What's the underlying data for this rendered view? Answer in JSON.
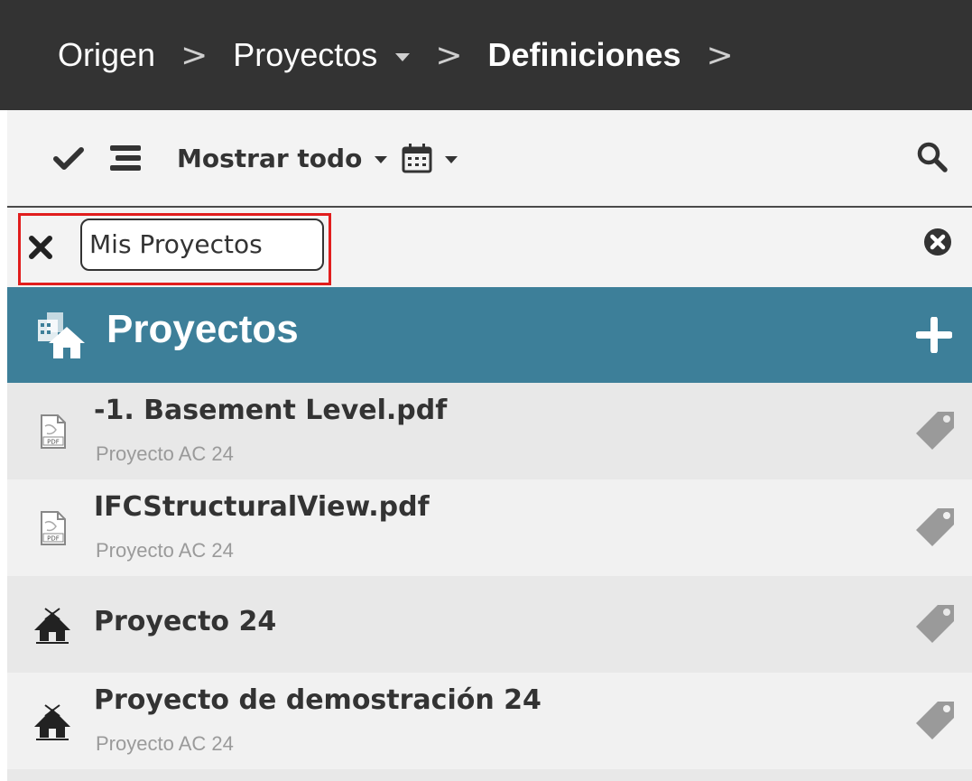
{
  "breadcrumb": {
    "items": [
      "Origen",
      "Proyectos",
      "Definiciones"
    ],
    "separator": ">"
  },
  "toolbar": {
    "check_icon": "check-icon",
    "list_icon": "list-icon",
    "filter_label": "Mostrar todo",
    "calendar_icon": "calendar-icon",
    "search_icon": "search-icon"
  },
  "filter": {
    "value": "Mis Proyectos",
    "remove_icon": "close-icon",
    "clear_icon": "clear-circle-icon"
  },
  "section": {
    "title": "Proyectos",
    "icon": "projects-icon",
    "add_icon": "plus-icon",
    "color": "#3d7f99"
  },
  "items": [
    {
      "title": "-1. Basement Level.pdf",
      "subtitle": "Proyecto AC 24",
      "icon": "pdf-icon"
    },
    {
      "title": "IFCStructuralView.pdf",
      "subtitle": "Proyecto AC 24",
      "icon": "pdf-icon"
    },
    {
      "title": "Proyecto 24",
      "subtitle": "",
      "icon": "project-house-icon"
    },
    {
      "title": "Proyecto de demostración 24",
      "subtitle": "Proyecto AC 24",
      "icon": "project-house-icon"
    }
  ],
  "colors": {
    "topbar": "#333333",
    "highlight": "#e11d1d",
    "tag": "#9a9a9a"
  }
}
